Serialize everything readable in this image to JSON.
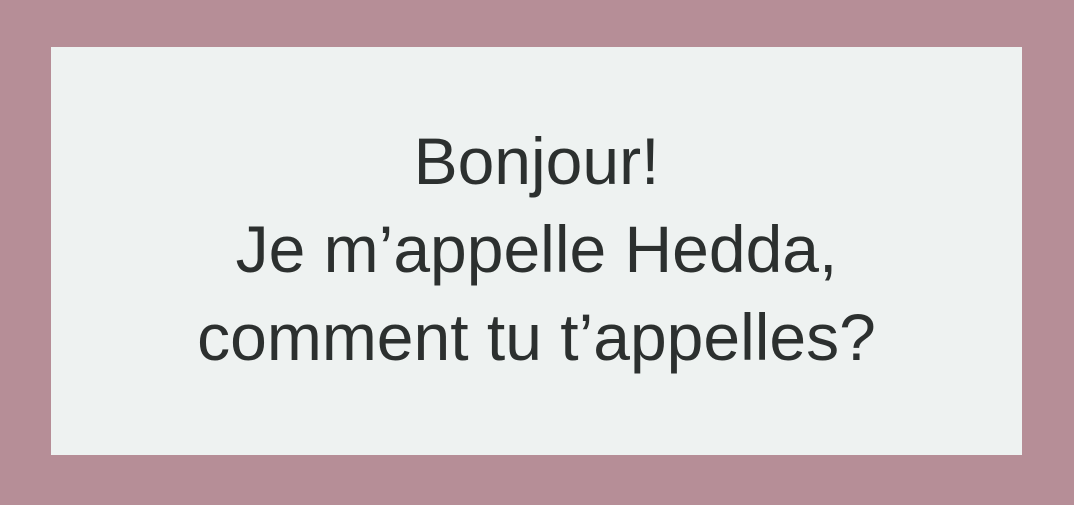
{
  "colors": {
    "background": "#b68e97",
    "card": "#eef2f1",
    "text": "#2c302f"
  },
  "message": {
    "lines": [
      "Bonjour!",
      "Je m’appelle Hedda,",
      "comment tu t’appelles?"
    ]
  }
}
